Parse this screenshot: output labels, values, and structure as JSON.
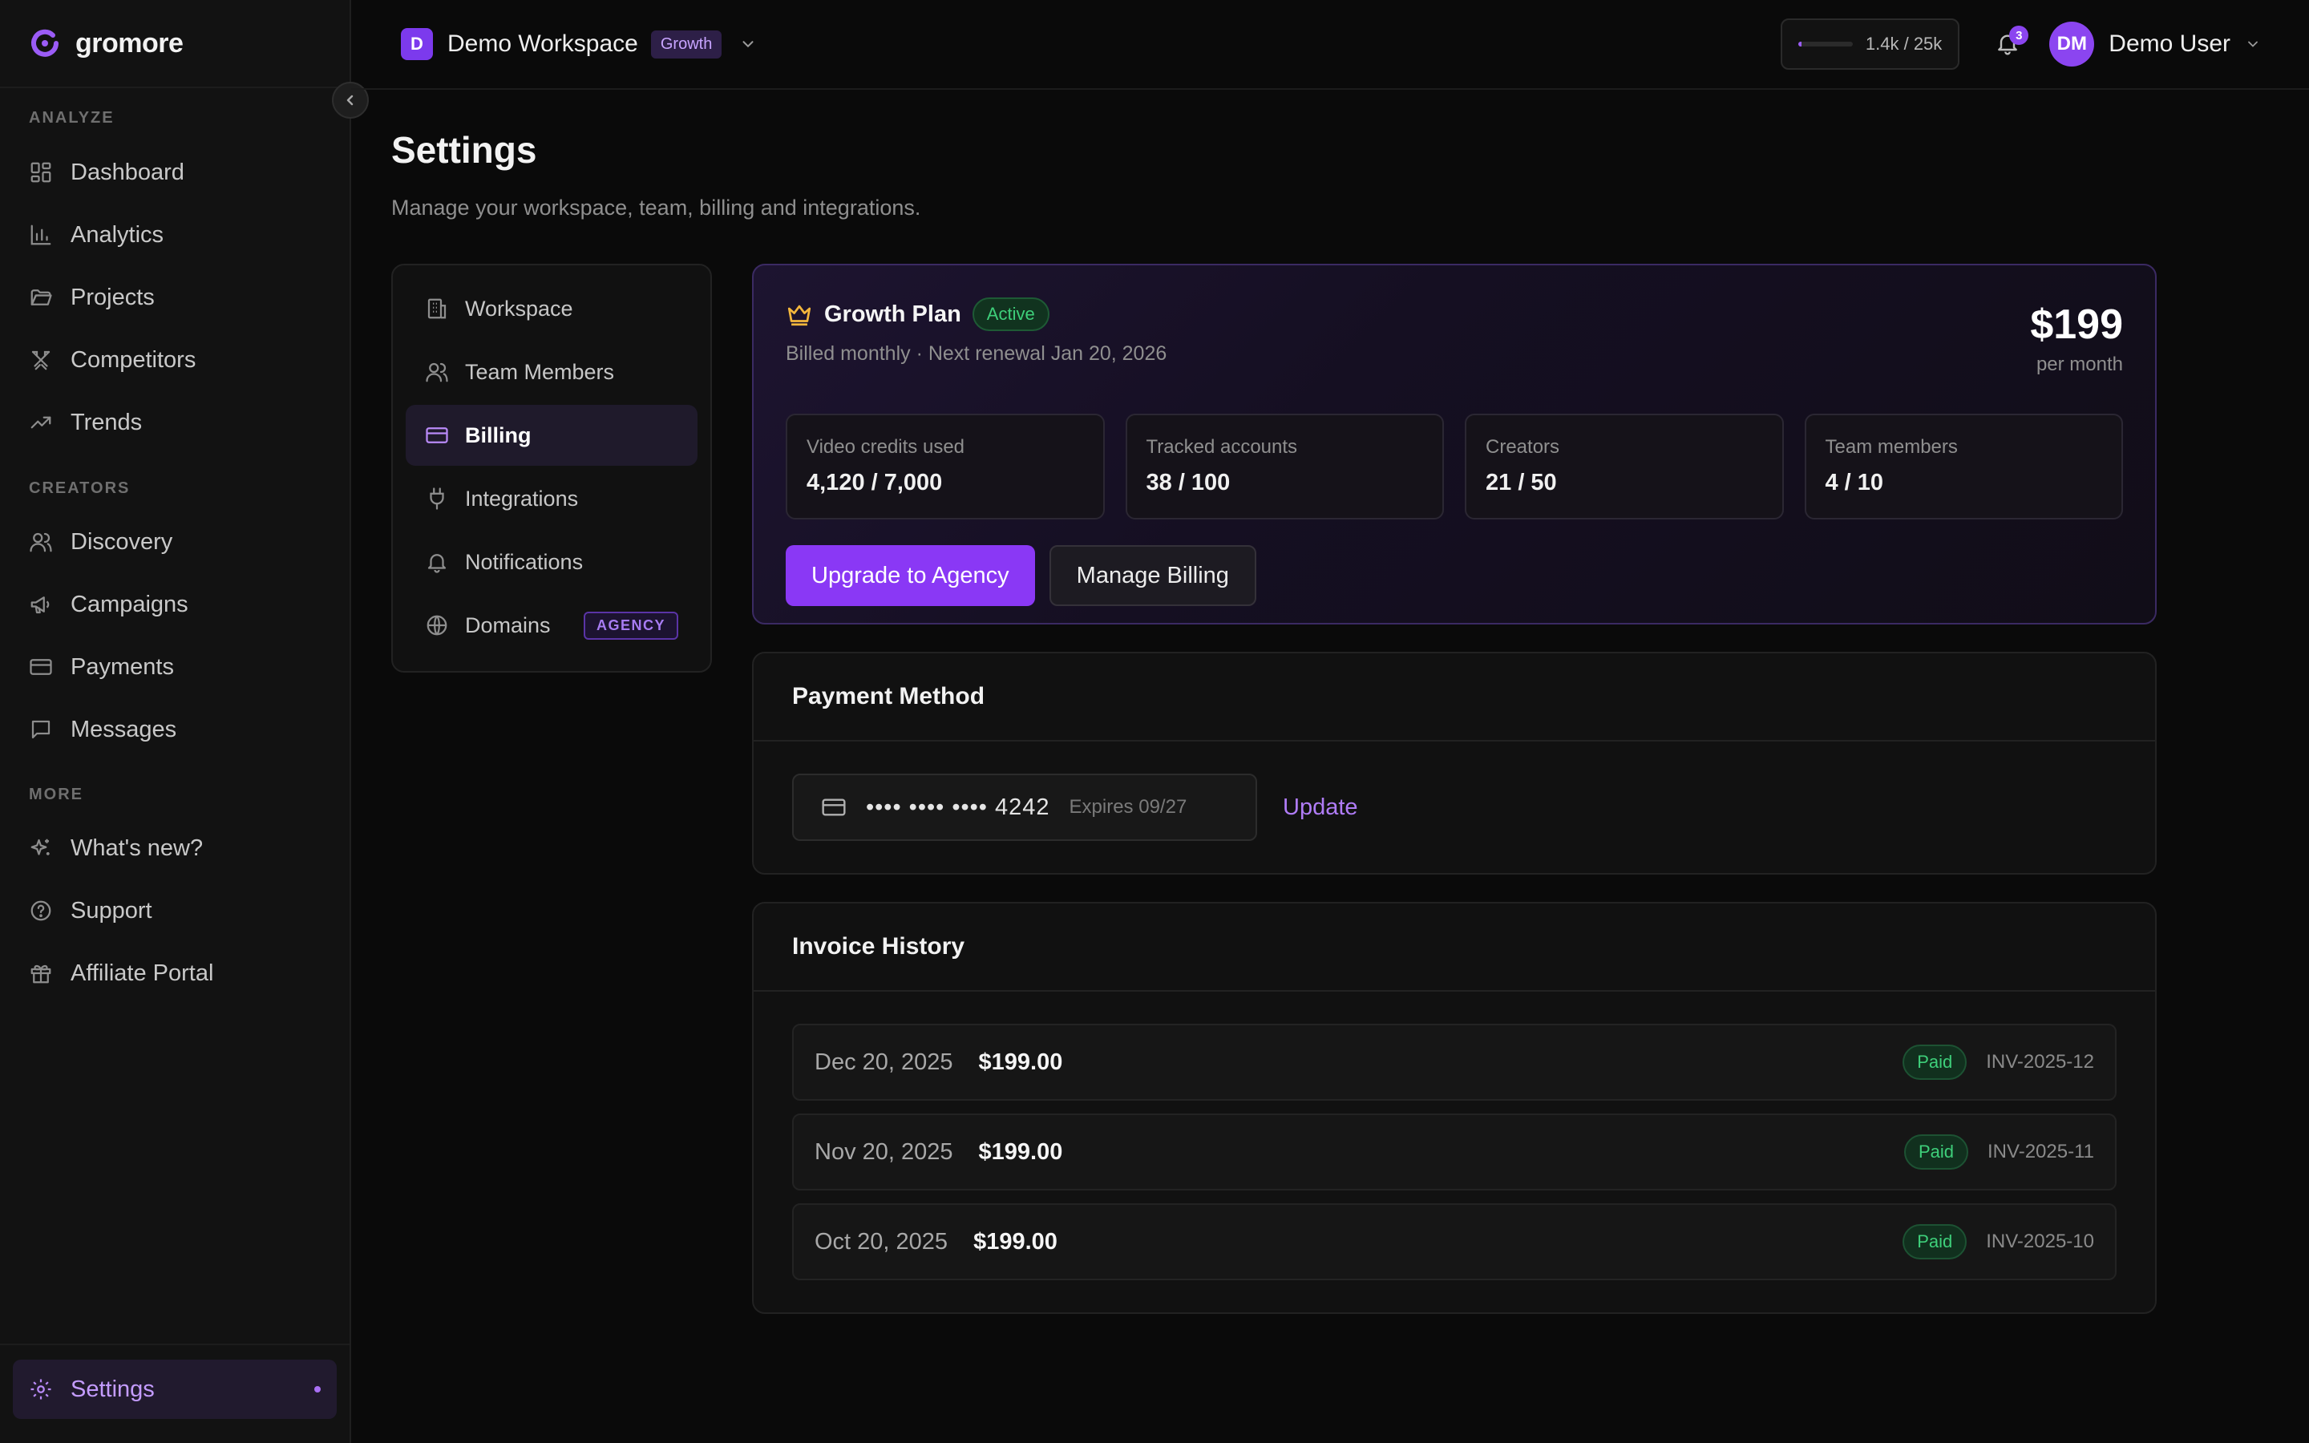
{
  "brand": {
    "name": "gromore",
    "accent": "#8a38f5"
  },
  "sidebar": {
    "sections": [
      {
        "title": "ANALYZE",
        "items": [
          {
            "label": "Dashboard",
            "icon": "dashboard-icon"
          },
          {
            "label": "Analytics",
            "icon": "bar-chart-icon"
          },
          {
            "label": "Projects",
            "icon": "folder-icon"
          },
          {
            "label": "Competitors",
            "icon": "swords-icon"
          },
          {
            "label": "Trends",
            "icon": "trend-up-icon"
          }
        ]
      },
      {
        "title": "CREATORS",
        "items": [
          {
            "label": "Discovery",
            "icon": "users-icon"
          },
          {
            "label": "Campaigns",
            "icon": "megaphone-icon"
          },
          {
            "label": "Payments",
            "icon": "credit-card-icon"
          },
          {
            "label": "Messages",
            "icon": "message-icon"
          }
        ]
      },
      {
        "title": "MORE",
        "items": [
          {
            "label": "What's new?",
            "icon": "sparkles-icon"
          },
          {
            "label": "Support",
            "icon": "help-circle-icon"
          },
          {
            "label": "Affiliate Portal",
            "icon": "gift-icon"
          }
        ]
      }
    ],
    "settings_label": "Settings"
  },
  "topbar": {
    "workspace_initial": "D",
    "workspace_name": "Demo Workspace",
    "workspace_plan_badge": "Growth",
    "usage_text": "1.4k / 25k",
    "usage_fraction": 0.056,
    "notification_count": "3",
    "user_initials": "DM",
    "user_name": "Demo User"
  },
  "page": {
    "title": "Settings",
    "subtitle": "Manage your workspace, team, billing and integrations."
  },
  "settings_nav": {
    "items": [
      {
        "label": "Workspace",
        "icon": "building-icon"
      },
      {
        "label": "Team Members",
        "icon": "users-icon"
      },
      {
        "label": "Billing",
        "icon": "credit-card-icon",
        "active": true
      },
      {
        "label": "Integrations",
        "icon": "plug-icon"
      },
      {
        "label": "Notifications",
        "icon": "bell-icon"
      },
      {
        "label": "Domains",
        "icon": "globe-icon",
        "tag": "AGENCY"
      }
    ]
  },
  "plan": {
    "name": "Growth Plan",
    "status": "Active",
    "billing_info": "Billed monthly · Next renewal Jan 20, 2026",
    "price": "$199",
    "period": "per month",
    "stats": [
      {
        "label": "Video credits used",
        "value": "4,120 / 7,000"
      },
      {
        "label": "Tracked accounts",
        "value": "38 / 100"
      },
      {
        "label": "Creators",
        "value": "21 / 50"
      },
      {
        "label": "Team members",
        "value": "4 / 10"
      }
    ],
    "upgrade_label": "Upgrade to Agency",
    "manage_label": "Manage Billing"
  },
  "payment_method": {
    "title": "Payment Method",
    "card_number": "•••• •••• •••• 4242",
    "expires": "Expires 09/27",
    "update_label": "Update"
  },
  "invoices": {
    "title": "Invoice History",
    "rows": [
      {
        "date": "Dec 20, 2025",
        "amount": "$199.00",
        "status": "Paid",
        "id": "INV-2025-12"
      },
      {
        "date": "Nov 20, 2025",
        "amount": "$199.00",
        "status": "Paid",
        "id": "INV-2025-11"
      },
      {
        "date": "Oct 20, 2025",
        "amount": "$199.00",
        "status": "Paid",
        "id": "INV-2025-10"
      }
    ]
  }
}
